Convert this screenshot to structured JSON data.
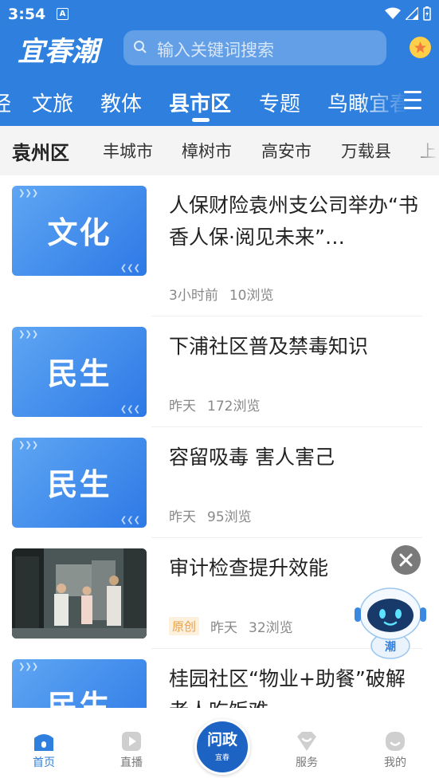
{
  "status": {
    "time": "3:54",
    "notif_letter": "A"
  },
  "header": {
    "logo_text": "宜春潮",
    "search_placeholder": "输入关键词搜索"
  },
  "categories": {
    "items": [
      "经",
      "文旅",
      "教体",
      "县市区",
      "专题",
      "鸟瞰宜春"
    ],
    "active": "县市区"
  },
  "subtabs": {
    "items": [
      "袁州区",
      "丰城市",
      "樟树市",
      "高安市",
      "万载县",
      "上"
    ],
    "active": "袁州区"
  },
  "articles": [
    {
      "thumb_label": "文化",
      "title": "人保财险袁州支公司举办“书香人保·阅见未来”…",
      "tag": "",
      "time": "3小时前",
      "views": "10浏览"
    },
    {
      "thumb_label": "民生",
      "title": "下浦社区普及禁毒知识",
      "tag": "",
      "time": "昨天",
      "views": "172浏览"
    },
    {
      "thumb_label": "民生",
      "title": "容留吸毒 害人害己",
      "tag": "",
      "time": "昨天",
      "views": "95浏览"
    },
    {
      "thumb_label": "",
      "title": "审计检查提升效能",
      "tag": "原创",
      "time": "昨天",
      "views": "32浏览"
    },
    {
      "thumb_label": "民生",
      "title": "桂园社区“物业+助餐”破解老人吃饭难",
      "tag": "",
      "time": "",
      "views": ""
    }
  ],
  "robot_label": "潮",
  "tabbar": {
    "home": "首页",
    "live": "直播",
    "center_main": "问政",
    "center_sub": "宜春",
    "service": "服务",
    "mine": "我的"
  },
  "colors": {
    "brand": "#2e7fde",
    "accent": "#e8a04c"
  }
}
